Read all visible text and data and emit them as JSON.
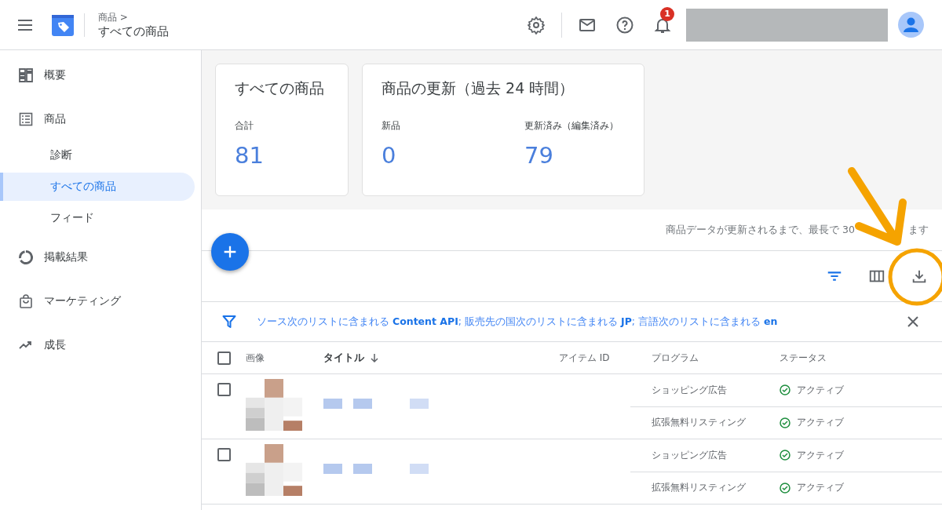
{
  "header": {
    "breadcrumb_parent": "商品 >",
    "title": "すべての商品",
    "notification_count": "1"
  },
  "sidebar": {
    "items": [
      {
        "label": "概要",
        "selected": false
      },
      {
        "label": "商品",
        "selected": false,
        "children": [
          {
            "label": "診断",
            "selected": false
          },
          {
            "label": "すべての商品",
            "selected": true
          },
          {
            "label": "フィード",
            "selected": false
          }
        ]
      },
      {
        "label": "掲載結果",
        "selected": false
      },
      {
        "label": "マーケティング",
        "selected": false
      },
      {
        "label": "成長",
        "selected": false
      }
    ]
  },
  "cards": [
    {
      "title": "すべての商品",
      "stats": [
        {
          "label": "合計",
          "value": "81"
        }
      ]
    },
    {
      "title": "商品の更新（過去 24 時間）",
      "stats": [
        {
          "label": "新品",
          "value": "0"
        },
        {
          "label": "更新済み（編集済み）",
          "value": "79"
        }
      ]
    }
  ],
  "notice": [
    "商品データが更新されるまで、最長で 30",
    "ます"
  ],
  "filter": {
    "text": "ソース次のリストに含まれる **Content API**; 販売先の国次のリストに含まれる **JP**; 言語次のリストに含まれる **en**"
  },
  "table": {
    "all_checked": false,
    "columns": [
      {
        "label": "画像",
        "sorted": false
      },
      {
        "label": "タイトル",
        "sorted": true
      },
      {
        "label": "アイテム ID",
        "sorted": false
      },
      {
        "label": "プログラム",
        "sorted": false
      },
      {
        "label": "ステータス",
        "sorted": false
      }
    ],
    "rows": [
      {
        "checked": false,
        "kind": "picture",
        "programs": [
          {
            "name": "ショッピング広告",
            "status": "アクティブ"
          },
          {
            "name": "拡張無料リスティング",
            "status": "アクティブ"
          }
        ]
      },
      {
        "checked": false,
        "kind": "picture",
        "programs": [
          {
            "name": "ショッピング広告",
            "status": "アクティブ"
          },
          {
            "name": "拡張無料リスティング",
            "status": "アクティブ"
          }
        ]
      }
    ]
  }
}
